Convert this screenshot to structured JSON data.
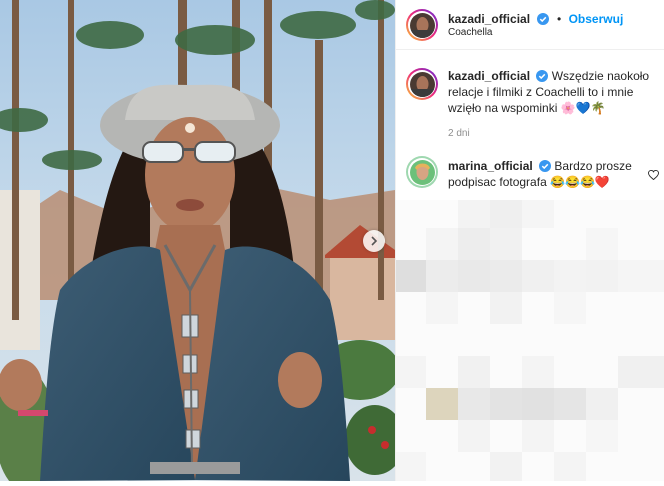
{
  "post": {
    "username": "kazadi_official",
    "follow_label": "Obserwuj",
    "location": "Coachella",
    "caption_text": "Wszędzie naokoło relacje i filmiki z Coachelli to i mnie wzięło na wspominki 🌸💙🌴",
    "time_ago": "2 dni"
  },
  "comments": [
    {
      "username": "marina_official",
      "text": "Bardzo prosze podpisac fotografa 😂😂😂❤️"
    }
  ],
  "colors": {
    "accent": "#0095f6",
    "verified": "#3897f0"
  },
  "icons": [
    "verified-badge-icon",
    "chevron-right-icon",
    "heart-icon"
  ]
}
